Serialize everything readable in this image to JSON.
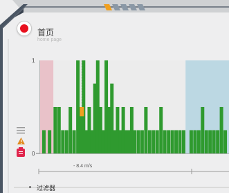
{
  "header": {
    "title": "首页",
    "subtitle": "home page"
  },
  "chart_data": {
    "type": "bar",
    "ylim": [
      0,
      1
    ],
    "y_ticks": [
      "1",
      "0"
    ],
    "x_marker_label": "- 8.4 m/s",
    "regions": [
      {
        "label": "",
        "color": "#e9c2c9",
        "x_start": 0,
        "x_end": 0.07
      },
      {
        "label": "",
        "color": "#bcd8e3",
        "x_start": 0.77,
        "x_end": 1.0
      }
    ],
    "bars_color": "#2f9a2f",
    "highlight_color": "#f0a020",
    "bars": [
      {
        "x": 0.02,
        "v": 0.25
      },
      {
        "x": 0.05,
        "v": 0.25
      },
      {
        "x": 0.08,
        "v": 0.5
      },
      {
        "x": 0.1,
        "v": 0.5
      },
      {
        "x": 0.12,
        "v": 0.25
      },
      {
        "x": 0.14,
        "v": 0.25
      },
      {
        "x": 0.16,
        "v": 0.5
      },
      {
        "x": 0.18,
        "v": 0.25
      },
      {
        "x": 0.2,
        "v": 1.0
      },
      {
        "x": 0.215,
        "v": 0.5
      },
      {
        "x": 0.23,
        "v": 1.0
      },
      {
        "x": 0.245,
        "v": 0.25
      },
      {
        "x": 0.26,
        "v": 0.5
      },
      {
        "x": 0.275,
        "v": 0.25
      },
      {
        "x": 0.29,
        "v": 0.75
      },
      {
        "x": 0.305,
        "v": 1.0
      },
      {
        "x": 0.32,
        "v": 0.5
      },
      {
        "x": 0.335,
        "v": 0.25
      },
      {
        "x": 0.35,
        "v": 1.0
      },
      {
        "x": 0.365,
        "v": 0.5
      },
      {
        "x": 0.38,
        "v": 0.75
      },
      {
        "x": 0.395,
        "v": 0.25
      },
      {
        "x": 0.41,
        "v": 0.5
      },
      {
        "x": 0.425,
        "v": 0.25
      },
      {
        "x": 0.44,
        "v": 0.5
      },
      {
        "x": 0.455,
        "v": 0.25
      },
      {
        "x": 0.47,
        "v": 0.25
      },
      {
        "x": 0.485,
        "v": 0.5
      },
      {
        "x": 0.5,
        "v": 0.25
      },
      {
        "x": 0.52,
        "v": 0.25
      },
      {
        "x": 0.54,
        "v": 0.25
      },
      {
        "x": 0.56,
        "v": 0.5
      },
      {
        "x": 0.58,
        "v": 0.25
      },
      {
        "x": 0.6,
        "v": 0.25
      },
      {
        "x": 0.62,
        "v": 0.25
      },
      {
        "x": 0.64,
        "v": 0.5
      },
      {
        "x": 0.66,
        "v": 0.25
      },
      {
        "x": 0.68,
        "v": 0.25
      },
      {
        "x": 0.7,
        "v": 0.25
      },
      {
        "x": 0.72,
        "v": 0.25
      },
      {
        "x": 0.74,
        "v": 0.25
      },
      {
        "x": 0.76,
        "v": 0.25
      },
      {
        "x": 0.8,
        "v": 0.25
      },
      {
        "x": 0.82,
        "v": 0.25
      },
      {
        "x": 0.84,
        "v": 0.25
      },
      {
        "x": 0.86,
        "v": 0.5
      },
      {
        "x": 0.88,
        "v": 0.25
      },
      {
        "x": 0.9,
        "v": 0.25
      },
      {
        "x": 0.92,
        "v": 0.25
      },
      {
        "x": 0.94,
        "v": 0.25
      },
      {
        "x": 0.96,
        "v": 0.5
      },
      {
        "x": 0.98,
        "v": 0.25
      }
    ],
    "highlight": {
      "x": 0.21,
      "v_low": 0.4,
      "v_high": 0.5
    }
  },
  "sidebar_tools": {
    "menu_icon": "menu-icon",
    "warning_icon": "warning-icon",
    "badge_icon": "badge-icon"
  },
  "filter": {
    "label": "过滤器"
  }
}
